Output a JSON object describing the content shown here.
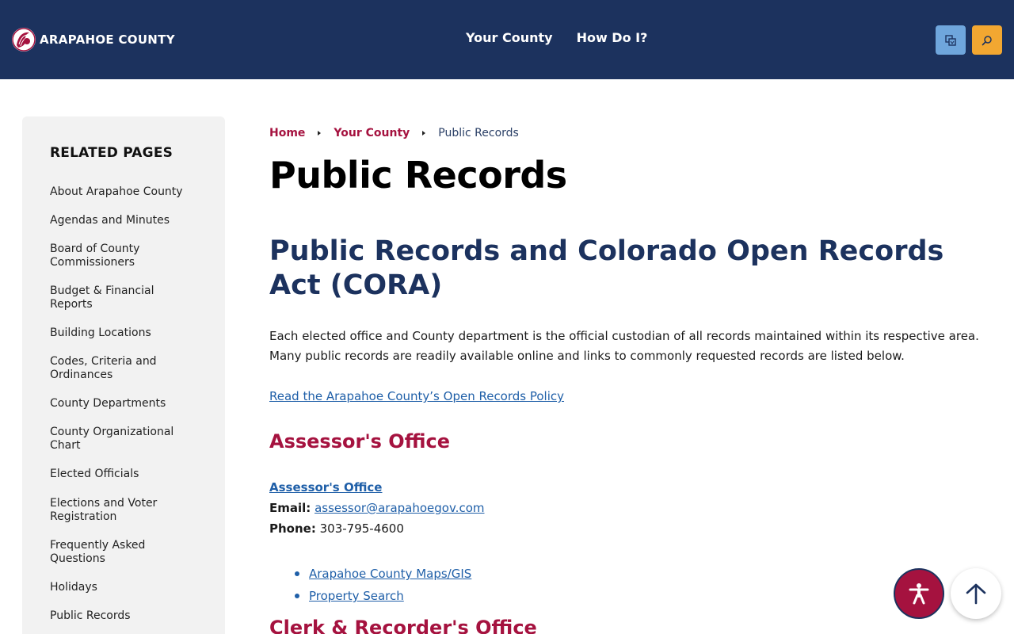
{
  "header": {
    "logo_text": "ARAPAHOE COUNTY",
    "logo_icon": "county-seal-icon",
    "nav": [
      "Your County",
      "How Do I?"
    ],
    "translate_icon": "translate-icon",
    "search_icon": "search-icon"
  },
  "sidebar": {
    "title": "RELATED PAGES",
    "items": [
      "About Arapahoe County",
      "Agendas and Minutes",
      "Board of County Commissioners",
      "Budget & Financial Reports",
      "Building Locations",
      "Codes, Criteria and Ordinances",
      "County Departments",
      "County Organizational Chart",
      "Elected Officials",
      "Elections and Voter Registration",
      "Frequently Asked Questions",
      "Holidays",
      "Public Records"
    ]
  },
  "breadcrumb": {
    "home": "Home",
    "parent": "Your County",
    "current": "Public Records"
  },
  "main": {
    "page_title": "Public Records",
    "section_title": "Public Records and Colorado Open Records Act (CORA)",
    "intro": "Each elected office and County department is the official custodian of all records maintained within its respective area. Many public records are readily available online and links to commonly requested records are listed below.",
    "policy_link": "Read the Arapahoe County’s Open Records Policy",
    "assessor": {
      "heading": "Assessor's Office",
      "link": "Assessor's Office",
      "email_label": "Email:",
      "email": "assessor@arapahoegov.com",
      "phone_label": "Phone:",
      "phone": "303-795-4600",
      "links": [
        "Arapahoe County Maps/GIS",
        "Property Search"
      ]
    },
    "clerk_heading": "Clerk & Recorder's Office"
  },
  "colors": {
    "header_bg": "#1c325e",
    "accent": "#a5123f",
    "link": "#1f5fa8",
    "translate_btn": "#6fa6dc",
    "search_btn": "#f2a731"
  },
  "fabs": {
    "accessibility_icon": "accessibility-icon",
    "top_icon": "arrow-up-icon"
  }
}
